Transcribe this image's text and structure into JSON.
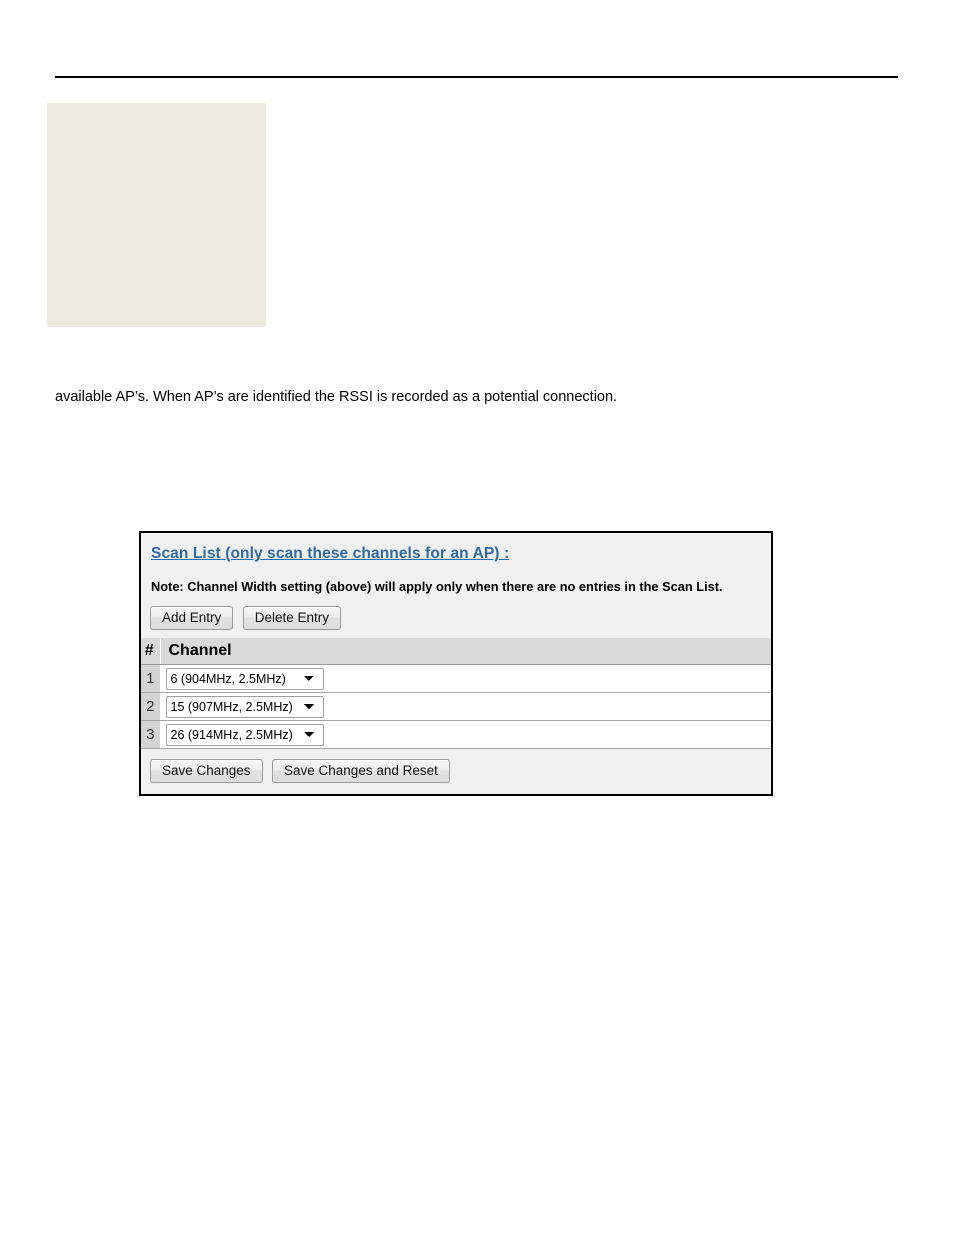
{
  "page": {
    "paragraph": "available AP’s. When AP’s are identified the RSSI is recorded as a potential connection."
  },
  "panel": {
    "title": "Scan List (only scan these channels for an AP) :",
    "note": "Note: Channel Width setting (above) will apply only when there are no entries in the  Scan List.",
    "toolbar": {
      "add_entry_label": "Add Entry",
      "delete_entry_label": "Delete Entry"
    },
    "table": {
      "headers": {
        "num": "#",
        "channel": "Channel"
      },
      "rows": [
        {
          "num": "1",
          "channel": "6 (904MHz, 2.5MHz)"
        },
        {
          "num": "2",
          "channel": "15 (907MHz, 2.5MHz)"
        },
        {
          "num": "3",
          "channel": "26 (914MHz, 2.5MHz)"
        }
      ]
    },
    "footer": {
      "save_changes_label": "Save Changes",
      "save_changes_and_reset_label": "Save Changes and Reset"
    }
  },
  "colors": {
    "link": "#2f6aa5",
    "panel_bg": "#f0f0f0",
    "panel_border": "#000000",
    "table_header_bg": "#d9d9d9",
    "num_col_bg": "#d4d4d4",
    "beige_block": "#edebdf"
  }
}
